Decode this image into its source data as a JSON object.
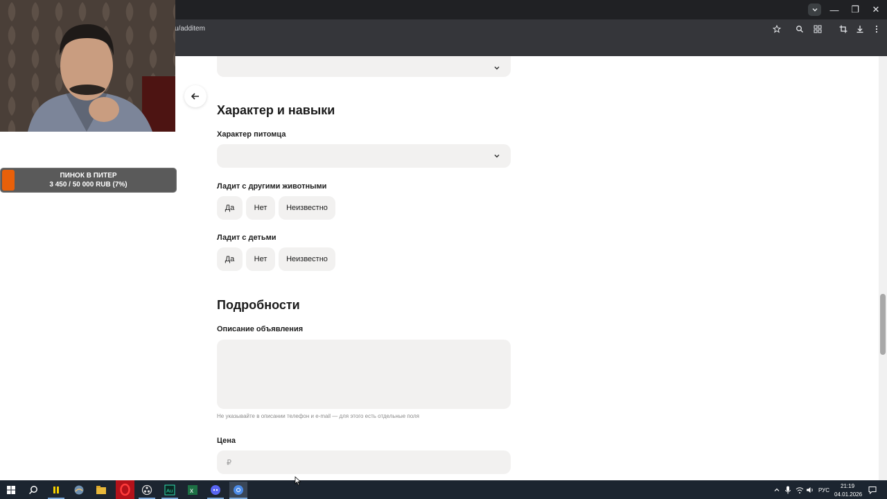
{
  "browser": {
    "url": "u/additem",
    "window_controls": {
      "minimize": "—",
      "restore": "❐",
      "close": "✕"
    }
  },
  "stream": {
    "donation_title": "ПИНОК В ПИТЕР",
    "donation_amount": "3 450 / 50 000 RUB (7%)",
    "donation_progress": 0.07,
    "donation_color": "#e8600a"
  },
  "form": {
    "section_character": "Характер и навыки",
    "pet_character_label": "Характер питомца",
    "pet_character_value": "",
    "with_animals_label": "Ладит с другими животными",
    "with_animals_options": [
      "Да",
      "Нет",
      "Неизвестно"
    ],
    "with_kids_label": "Ладит с детьми",
    "with_kids_options": [
      "Да",
      "Нет",
      "Неизвестно"
    ],
    "section_details": "Подробности",
    "description_label": "Описание объявления",
    "description_value": "",
    "description_hint": "Не указывайте в описании телефон и e-mail — для этого есть отдельные поля",
    "price_label": "Цена",
    "price_placeholder": "₽"
  },
  "taskbar": {
    "language": "РУС",
    "time": "21:19",
    "date": "04.01.2026"
  },
  "colors": {
    "field_bg": "#f2f1f0",
    "taskbar_bg": "#1c2530",
    "browser_dark": "#202124"
  }
}
